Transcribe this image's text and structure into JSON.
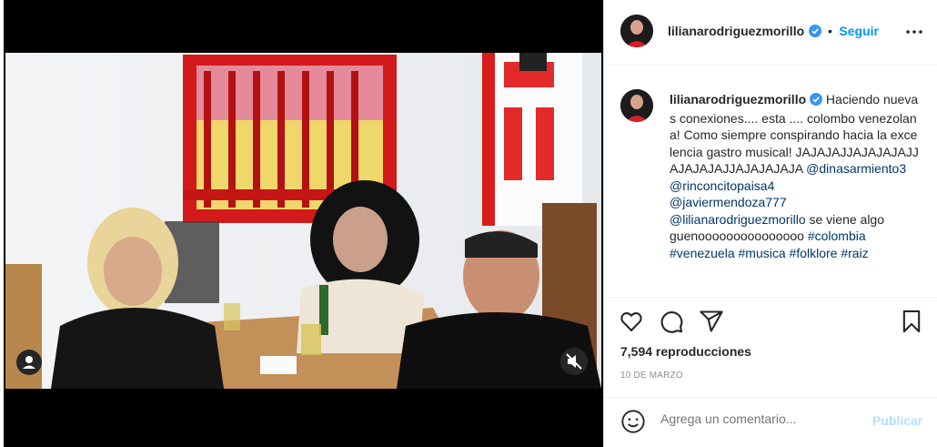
{
  "post": {
    "username": "lilianarodriguezmorillo",
    "follow_label": "Seguir",
    "follow_separator": "•",
    "more_icon": "more-options-icon",
    "caption_username": "lilianarodriguezmorillo",
    "caption_intro": "Haciendo nuevas conexiones.... esta .... colombo venezolana! Como siempre conspirando hacia la excelencia gastro musical! JAJAJAJJAJAJAJAJJAJAJAJAJJAJAJAJAJA",
    "mentions": [
      "@dinasarmiento3",
      "@rinconcitopaisa4",
      "@javiermendoza777",
      "@lilianarodriguezmorillo"
    ],
    "caption_tail": "se viene algo guenooooooooooooooo",
    "hashtags": [
      "#colombia",
      "#venezuela",
      "#musica",
      "#folklore",
      "#raiz"
    ],
    "views": "7,594 reproducciones",
    "date": "10 DE MARZO"
  },
  "comment": {
    "placeholder": "Agrega un comentario...",
    "publish_label": "Publicar"
  },
  "colors": {
    "accent": "#0095f6",
    "link": "#00376b",
    "verified": "#3897f0",
    "publish_disabled": "#b2dffc"
  },
  "icons": [
    "heart-icon",
    "comment-icon",
    "share-icon",
    "bookmark-icon",
    "emoji-icon",
    "mute-icon",
    "user-tag-icon",
    "verified-badge-icon"
  ]
}
